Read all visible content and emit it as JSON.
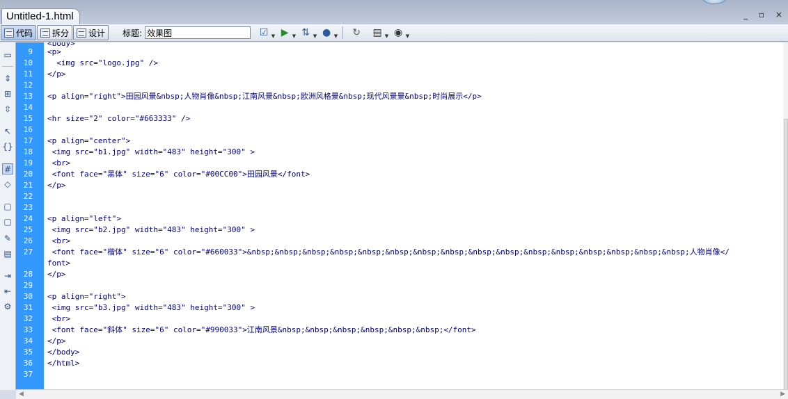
{
  "document_tab": {
    "title": "Untitled-1.html"
  },
  "window_controls": "_ ▫ ×",
  "toolbar": {
    "code_label": "代码",
    "split_label": "拆分",
    "design_label": "设计",
    "title_label": "标题:",
    "title_value": "效果图",
    "tools": [
      "validate-icon",
      "preview-icon",
      "file-transfer-icon",
      "browser-check-icon",
      "refresh-icon",
      "view-options-icon",
      "visual-aids-icon"
    ]
  },
  "left_tools": [
    "open-documents-icon",
    "collapse-tag-icon",
    "collapse-selection-icon",
    "expand-all-icon",
    "select-parent-icon",
    "balance-braces-icon",
    "line-numbers-icon",
    "highlight-invalid-icon",
    "apply-comment-icon",
    "remove-comment-icon",
    "wrap-tag-icon",
    "recent-snippets-icon",
    "indent-icon",
    "outdent-icon",
    "format-source-icon"
  ],
  "gutter": {
    "line_numbers": [
      "9",
      "10",
      "11",
      "12",
      "13",
      "14",
      "15",
      "16",
      "17",
      "18",
      "19",
      "20",
      "21",
      "22",
      "23",
      "24",
      "25",
      "26",
      "27",
      "",
      "28",
      "29",
      "30",
      "31",
      "32",
      "33",
      "34",
      "35",
      "36",
      "37"
    ]
  },
  "code": {
    "lines": [
      "<p>",
      "  <img src=\"logo.jpg\" />",
      "</p>",
      "",
      "<p align=\"right\">田园风景&nbsp;人物肖像&nbsp;江南风景&nbsp;欧洲风格景&nbsp;现代风景景&nbsp;时尚展示</p>",
      "",
      "<hr size=\"2\" color=\"#663333\" />",
      "",
      "<p align=\"center\">",
      " <img src=\"b1.jpg\" width=\"483\" height=\"300\" >",
      " <br>",
      " <font face=\"黑体\" size=\"6\" color=\"#00CC00\">田园风景</font>",
      "</p>",
      "",
      "",
      "<p align=\"left\">",
      " <img src=\"b2.jpg\" width=\"483\" height=\"300\" >",
      " <br>",
      " <font face=\"楷体\" size=\"6\" color=\"#660033\">&nbsp;&nbsp;&nbsp;&nbsp;&nbsp;&nbsp;&nbsp;&nbsp;&nbsp;&nbsp;&nbsp;&nbsp;&nbsp;&nbsp;&nbsp;&nbsp;人物肖像</",
      "font>",
      "</p>",
      "",
      "<p align=\"right\">",
      " <img src=\"b3.jpg\" width=\"483\" height=\"300\" >",
      " <br>",
      " <font face=\"斜体\" size=\"6\" color=\"#990033\">江南风景&nbsp;&nbsp;&nbsp;&nbsp;&nbsp;&nbsp;</font>",
      "</p>",
      "</body>",
      "</html>",
      ""
    ]
  }
}
